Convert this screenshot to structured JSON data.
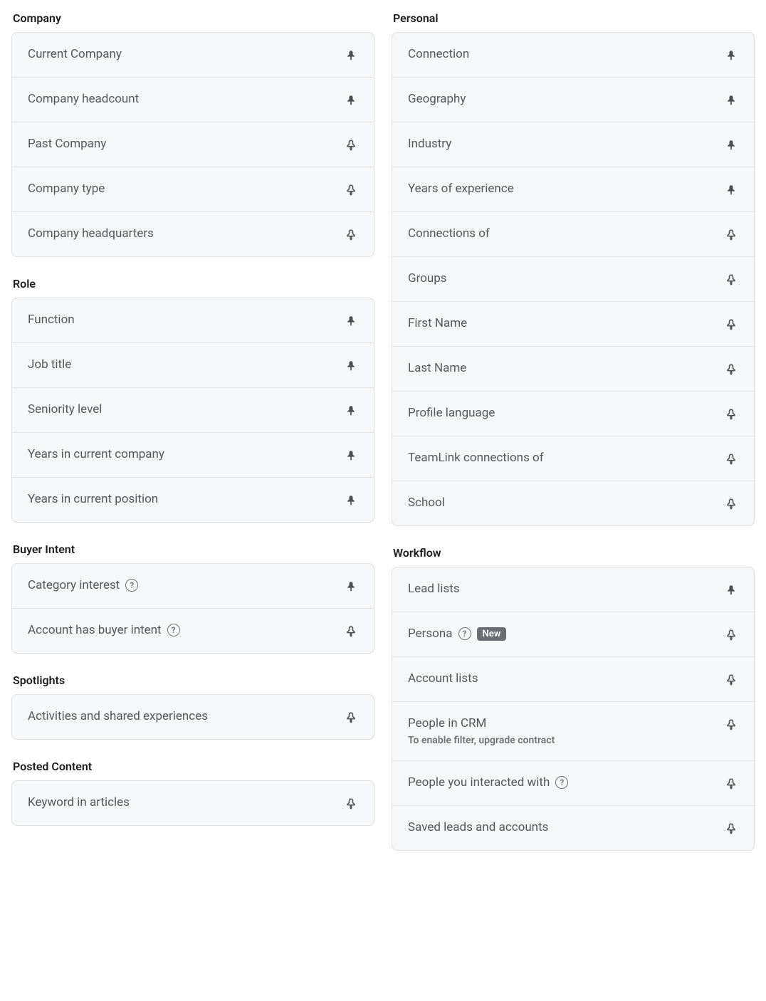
{
  "columns": [
    {
      "sections": [
        {
          "title": "Company",
          "items": [
            {
              "label": "Current Company",
              "pinned": true,
              "help": false,
              "badge": null,
              "sub": null
            },
            {
              "label": "Company headcount",
              "pinned": true,
              "help": false,
              "badge": null,
              "sub": null
            },
            {
              "label": "Past Company",
              "pinned": false,
              "help": false,
              "badge": null,
              "sub": null
            },
            {
              "label": "Company type",
              "pinned": false,
              "help": false,
              "badge": null,
              "sub": null
            },
            {
              "label": "Company headquarters",
              "pinned": false,
              "help": false,
              "badge": null,
              "sub": null
            }
          ]
        },
        {
          "title": "Role",
          "items": [
            {
              "label": "Function",
              "pinned": true,
              "help": false,
              "badge": null,
              "sub": null
            },
            {
              "label": "Job title",
              "pinned": true,
              "help": false,
              "badge": null,
              "sub": null
            },
            {
              "label": "Seniority level",
              "pinned": true,
              "help": false,
              "badge": null,
              "sub": null
            },
            {
              "label": "Years in current company",
              "pinned": true,
              "help": false,
              "badge": null,
              "sub": null
            },
            {
              "label": "Years in current position",
              "pinned": true,
              "help": false,
              "badge": null,
              "sub": null
            }
          ]
        },
        {
          "title": "Buyer Intent",
          "items": [
            {
              "label": "Category interest",
              "pinned": true,
              "help": true,
              "badge": null,
              "sub": null
            },
            {
              "label": "Account has buyer intent",
              "pinned": false,
              "help": true,
              "badge": null,
              "sub": null
            }
          ]
        },
        {
          "title": "Spotlights",
          "items": [
            {
              "label": "Activities and shared experiences",
              "pinned": false,
              "help": false,
              "badge": null,
              "sub": null
            }
          ]
        },
        {
          "title": "Posted Content",
          "items": [
            {
              "label": "Keyword in articles",
              "pinned": false,
              "help": false,
              "badge": null,
              "sub": null
            }
          ]
        }
      ]
    },
    {
      "sections": [
        {
          "title": "Personal",
          "items": [
            {
              "label": "Connection",
              "pinned": true,
              "help": false,
              "badge": null,
              "sub": null
            },
            {
              "label": "Geography",
              "pinned": true,
              "help": false,
              "badge": null,
              "sub": null
            },
            {
              "label": "Industry",
              "pinned": true,
              "help": false,
              "badge": null,
              "sub": null
            },
            {
              "label": "Years of experience",
              "pinned": true,
              "help": false,
              "badge": null,
              "sub": null
            },
            {
              "label": "Connections of",
              "pinned": false,
              "help": false,
              "badge": null,
              "sub": null
            },
            {
              "label": "Groups",
              "pinned": false,
              "help": false,
              "badge": null,
              "sub": null
            },
            {
              "label": "First Name",
              "pinned": false,
              "help": false,
              "badge": null,
              "sub": null
            },
            {
              "label": "Last Name",
              "pinned": false,
              "help": false,
              "badge": null,
              "sub": null
            },
            {
              "label": "Profile language",
              "pinned": false,
              "help": false,
              "badge": null,
              "sub": null
            },
            {
              "label": "TeamLink connections of",
              "pinned": false,
              "help": false,
              "badge": null,
              "sub": null
            },
            {
              "label": "School",
              "pinned": false,
              "help": false,
              "badge": null,
              "sub": null
            }
          ]
        },
        {
          "title": "Workflow",
          "items": [
            {
              "label": "Lead lists",
              "pinned": true,
              "help": false,
              "badge": null,
              "sub": null
            },
            {
              "label": "Persona",
              "pinned": false,
              "help": true,
              "badge": "New",
              "sub": null
            },
            {
              "label": "Account lists",
              "pinned": false,
              "help": false,
              "badge": null,
              "sub": null
            },
            {
              "label": "People in CRM",
              "pinned": false,
              "help": false,
              "badge": null,
              "sub": "To enable filter, upgrade contract"
            },
            {
              "label": "People you interacted with",
              "pinned": false,
              "help": true,
              "badge": null,
              "sub": null
            },
            {
              "label": "Saved leads and accounts",
              "pinned": false,
              "help": false,
              "badge": null,
              "sub": null
            }
          ]
        }
      ]
    }
  ]
}
